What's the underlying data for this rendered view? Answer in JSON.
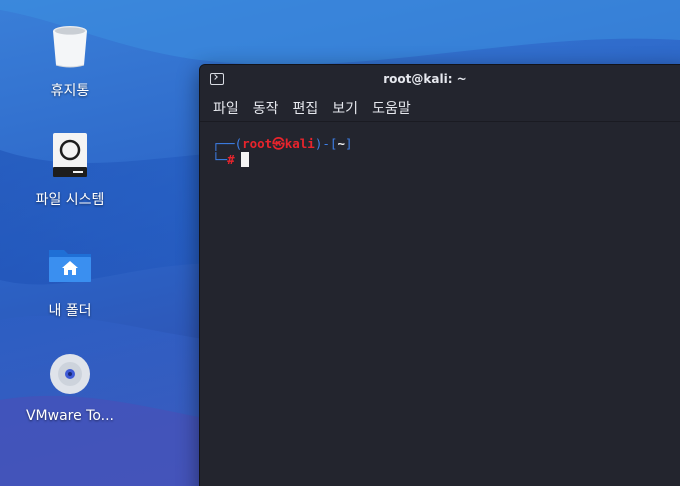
{
  "desktop": {
    "icons": [
      {
        "label": "휴지통",
        "icon": "trash-icon"
      },
      {
        "label": "파일 시스템",
        "icon": "drive-icon"
      },
      {
        "label": "내 폴더",
        "icon": "home-folder-icon"
      },
      {
        "label": "VMware To...",
        "icon": "disc-icon"
      }
    ]
  },
  "terminal": {
    "title": "root@kali: ~",
    "menu": [
      "파일",
      "동작",
      "편집",
      "보기",
      "도움말"
    ],
    "prompt": {
      "corner_top": "┌──",
      "open_paren": "(",
      "user": "root",
      "at_symbol": "㉿",
      "host": "kali",
      "close_paren": ")",
      "dash": "-",
      "open_bracket": "[",
      "dir": "~",
      "close_bracket": "]",
      "corner_bottom": "└─",
      "symbol": "#"
    }
  },
  "colors": {
    "prompt_frame": "#3d7fe8",
    "prompt_user": "#e8242c",
    "terminal_bg": "#23252e"
  }
}
